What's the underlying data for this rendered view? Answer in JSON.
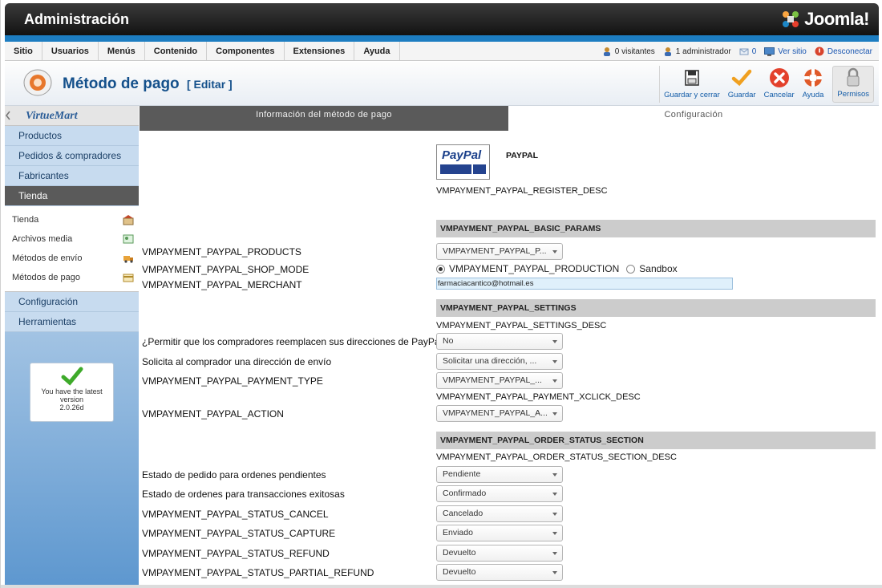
{
  "header": {
    "title": "Administración",
    "brand": "Joomla!"
  },
  "menu": [
    "Sitio",
    "Usuarios",
    "Menús",
    "Contenido",
    "Componentes",
    "Extensiones",
    "Ayuda"
  ],
  "status": {
    "visitors": "0 visitantes",
    "admins": "1 administrador",
    "messages": "0",
    "view_site": "Ver sitio",
    "logout": "Desconectar"
  },
  "page": {
    "title": "Método de pago",
    "subtitle": "[ Editar ]"
  },
  "toolbar": {
    "save_close": "Guardar y cerrar",
    "save": "Guardar",
    "cancel": "Cancelar",
    "help": "Ayuda",
    "permissions": "Permisos"
  },
  "sidebar": {
    "logo": "VirtueMart",
    "items": [
      {
        "label": "Productos"
      },
      {
        "label": "Pedidos & compradores"
      },
      {
        "label": "Fabricantes"
      },
      {
        "label": "Tienda"
      }
    ],
    "subitems": [
      {
        "label": "Tienda"
      },
      {
        "label": "Archivos media"
      },
      {
        "label": "Métodos de envío"
      },
      {
        "label": "Métodos de pago"
      }
    ],
    "bottom_items": [
      {
        "label": "Configuración"
      },
      {
        "label": "Herramientas"
      }
    ],
    "version": {
      "line1": "You have the latest",
      "line2": "version",
      "line3": "2.0.26d"
    }
  },
  "tabs": {
    "info": "Información del método de pago",
    "config": "Configuración"
  },
  "form": {
    "paypal_name": "PAYPAL",
    "paypal_logo": "PayPal",
    "register_desc": "VMPAYMENT_PAYPAL_REGISTER_DESC",
    "basic_params": "VMPAYMENT_PAYPAL_BASIC_PARAMS",
    "products_label": "VMPAYMENT_PAYPAL_PRODUCTS",
    "products_value": "VMPAYMENT_PAYPAL_P...",
    "shop_mode_label": "VMPAYMENT_PAYPAL_SHOP_MODE",
    "shop_mode_production": "VMPAYMENT_PAYPAL_PRODUCTION",
    "shop_mode_sandbox": "Sandbox",
    "merchant_label": "VMPAYMENT_PAYPAL_MERCHANT",
    "merchant_value": "farmaciacantico@hotmail.es",
    "settings": "VMPAYMENT_PAYPAL_SETTINGS",
    "settings_desc": "VMPAYMENT_PAYPAL_SETTINGS_DESC",
    "override_label": "¿Permitir que los compradores reemplacen sus direcciones de PayPal?",
    "override_value": "No",
    "shipping_label": "Solicita al comprador una dirección de envío",
    "shipping_value": "Solicitar una dirección, ...",
    "payment_type_label": "VMPAYMENT_PAYPAL_PAYMENT_TYPE",
    "payment_type_value": "VMPAYMENT_PAYPAL_...",
    "xclick_desc": "VMPAYMENT_PAYPAL_PAYMENT_XCLICK_DESC",
    "action_label": "VMPAYMENT_PAYPAL_ACTION",
    "action_value": "VMPAYMENT_PAYPAL_A...",
    "order_status_section": "VMPAYMENT_PAYPAL_ORDER_STATUS_SECTION",
    "order_status_desc": "VMPAYMENT_PAYPAL_ORDER_STATUS_SECTION_DESC",
    "pending_label": "Estado de pedido para ordenes pendientes",
    "pending_value": "Pendiente",
    "success_label": "Estado de ordenes para transacciones exitosas",
    "success_value": "Confirmado",
    "cancel_label": "VMPAYMENT_PAYPAL_STATUS_CANCEL",
    "cancel_value": "Cancelado",
    "capture_label": "VMPAYMENT_PAYPAL_STATUS_CAPTURE",
    "capture_value": "Enviado",
    "refund_label": "VMPAYMENT_PAYPAL_STATUS_REFUND",
    "refund_value": "Devuelto",
    "partial_refund_label": "VMPAYMENT_PAYPAL_STATUS_PARTIAL_REFUND",
    "partial_refund_value": "Devuelto"
  }
}
